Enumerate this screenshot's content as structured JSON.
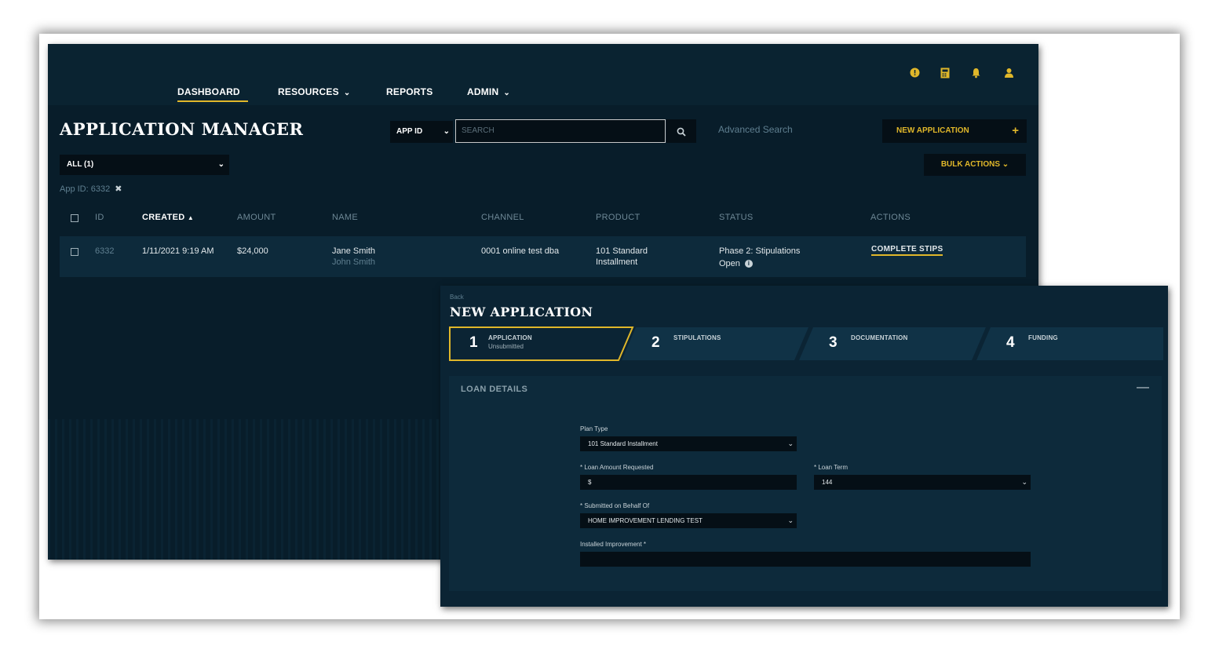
{
  "nav": {
    "items": [
      {
        "label": "DASHBOARD",
        "has_dropdown": false,
        "active": true
      },
      {
        "label": "RESOURCES",
        "has_dropdown": true
      },
      {
        "label": "REPORTS",
        "has_dropdown": false
      },
      {
        "label": "ADMIN",
        "has_dropdown": true
      }
    ],
    "icons": [
      "help-icon",
      "calculator-icon",
      "bell-icon",
      "user-icon"
    ]
  },
  "page": {
    "title": "APPLICATION MANAGER",
    "search_type": "APP ID",
    "search_placeholder": "SEARCH",
    "advanced_search": "Advanced Search",
    "new_application": "NEW APPLICATION",
    "new_application_icon": "+",
    "bulk_actions": "BULK ACTIONS",
    "filter": "ALL (1)",
    "active_filter": "App ID: 6332"
  },
  "table": {
    "headers": {
      "id": "ID",
      "created": "CREATED",
      "amount": "AMOUNT",
      "name": "NAME",
      "channel": "CHANNEL",
      "product": "PRODUCT",
      "status": "STATUS",
      "actions": "ACTIONS"
    },
    "sort_indicator": "▲",
    "rows": [
      {
        "id": "6332",
        "created": "1/11/2021 9:19 AM",
        "amount": "$24,000",
        "name": "Jane Smith",
        "co_name": "John Smith",
        "channel": "0001 online test dba",
        "product_line1": "101 Standard",
        "product_line2": "Installment",
        "status_line1": "Phase 2: Stipulations",
        "status_line2": "Open",
        "action": "COMPLETE STIPS"
      }
    ]
  },
  "modal": {
    "back": "Back",
    "title": "NEW APPLICATION",
    "steps": [
      {
        "num": "1",
        "label": "APPLICATION",
        "sub": "Unsubmitted",
        "active": true
      },
      {
        "num": "2",
        "label": "STIPULATIONS",
        "sub": ""
      },
      {
        "num": "3",
        "label": "DOCUMENTATION",
        "sub": ""
      },
      {
        "num": "4",
        "label": "FUNDING",
        "sub": ""
      }
    ],
    "section_title": "LOAN DETAILS",
    "collapse_symbol": "—",
    "fields": {
      "plan_type_label": "Plan Type",
      "plan_type_value": "101 Standard Installment",
      "loan_amount_label": "* Loan Amount Requested",
      "loan_amount_value": "$",
      "loan_term_label": "* Loan Term",
      "loan_term_value": "144",
      "behalf_label": "* Submitted on Behalf Of",
      "behalf_value": "HOME IMPROVEMENT LENDING TEST",
      "improvement_label": "Installed Improvement *",
      "improvement_value": ""
    }
  },
  "colors": {
    "accent": "#e0b72a",
    "background": "#0b2434",
    "input_bg": "#050f16"
  }
}
